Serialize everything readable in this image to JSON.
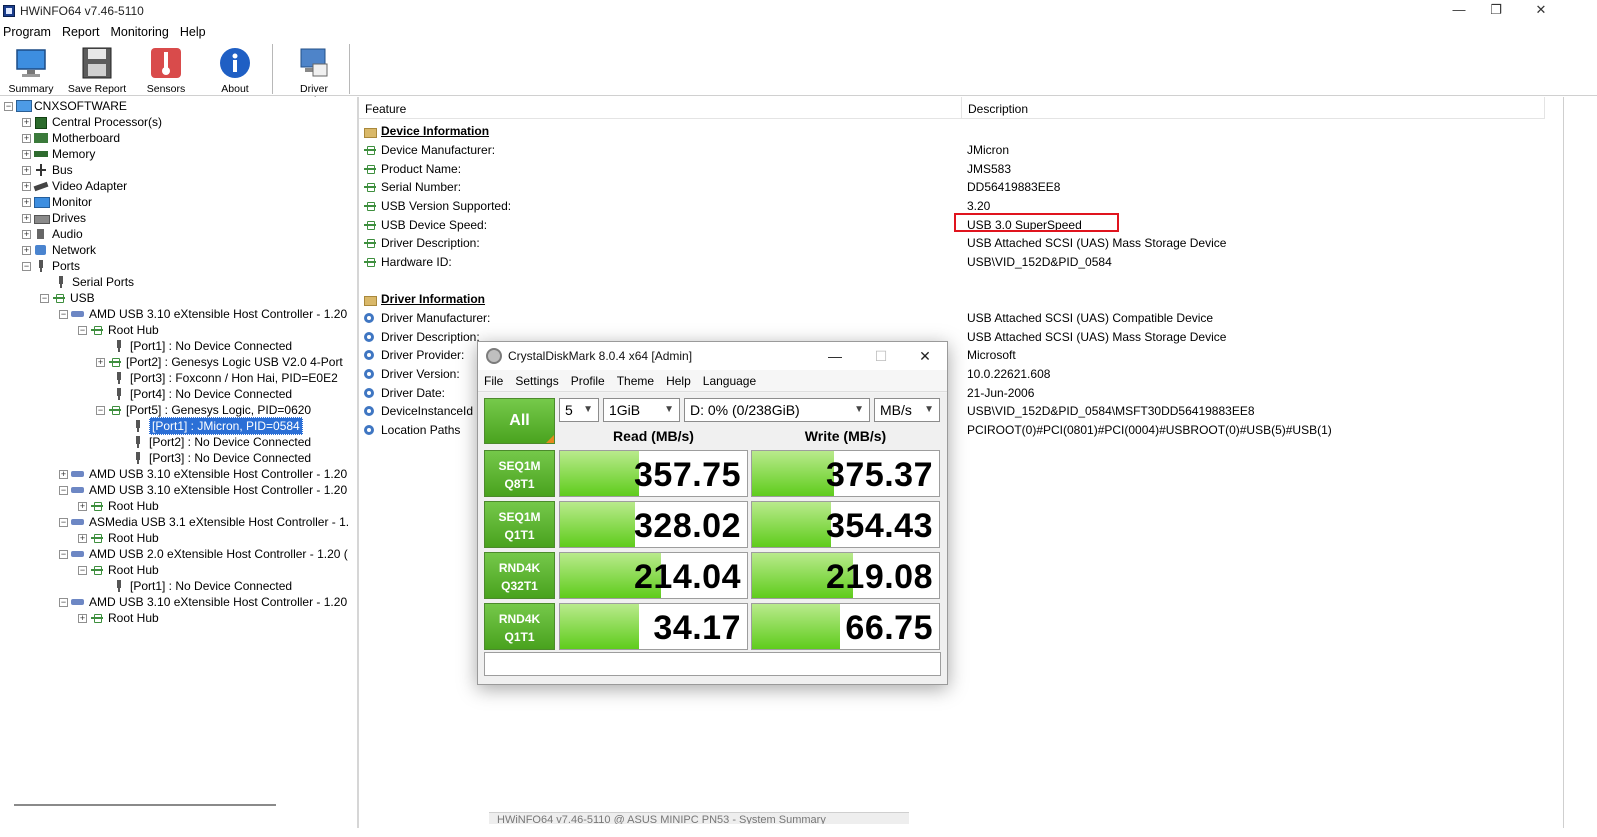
{
  "window": {
    "title": "HWiNFO64 v7.46-5110",
    "minimize": "—",
    "maximize": "❐",
    "close": "✕"
  },
  "menu": [
    "Program",
    "Report",
    "Monitoring",
    "Help"
  ],
  "toolbar": {
    "summary": "Summary",
    "save_report": "Save Report",
    "sensors": "Sensors",
    "about": "About",
    "driver_update": "Driver Update"
  },
  "tree": {
    "root": "CNXSOFTWARE",
    "items": [
      "Central Processor(s)",
      "Motherboard",
      "Memory",
      "Bus",
      "Video Adapter",
      "Monitor",
      "Drives",
      "Audio",
      "Network",
      "Ports",
      "Serial Ports",
      "USB",
      "AMD USB 3.10 eXtensible Host Controller - 1.20",
      "Root Hub",
      "[Port1] : No Device Connected",
      "[Port2] : Genesys Logic USB V2.0 4-Port",
      "[Port3] : Foxconn / Hon Hai, PID=E0E2",
      "[Port4] : No Device Connected",
      "[Port5] : Genesys Logic, PID=0620",
      "[Port1] : JMicron, PID=0584",
      "[Port2] : No Device Connected",
      "[Port3] : No Device Connected",
      "AMD USB 3.10 eXtensible Host Controller - 1.20",
      "AMD USB 3.10 eXtensible Host Controller - 1.20",
      "Root Hub",
      "ASMedia USB 3.1 eXtensible Host Controller - 1.",
      "Root Hub",
      "AMD USB 2.0 eXtensible Host Controller - 1.20 (",
      "Root Hub",
      "[Port1] : No Device Connected",
      "AMD USB 3.10 eXtensible Host Controller - 1.20",
      "Root Hub"
    ]
  },
  "table": {
    "col_feature": "Feature",
    "col_description": "Description",
    "section1": "Device Information",
    "device_rows": [
      {
        "feature": "Device Manufacturer:",
        "value": "JMicron"
      },
      {
        "feature": "Product Name:",
        "value": "JMS583"
      },
      {
        "feature": "Serial Number:",
        "value": "DD56419883EE8"
      },
      {
        "feature": "USB Version Supported:",
        "value": "3.20"
      },
      {
        "feature": "USB Device Speed:",
        "value": "USB 3.0 SuperSpeed"
      },
      {
        "feature": "Driver Description:",
        "value": "USB Attached SCSI (UAS) Mass Storage Device"
      },
      {
        "feature": "Hardware ID:",
        "value": "USB\\VID_152D&PID_0584"
      }
    ],
    "section2": "Driver Information",
    "driver_rows": [
      {
        "feature": "Driver Manufacturer:",
        "value": "USB Attached SCSI (UAS) Compatible Device"
      },
      {
        "feature": "Driver Description:",
        "value": "USB Attached SCSI (UAS) Mass Storage Device"
      },
      {
        "feature": "Driver Provider:",
        "value": "Microsoft"
      },
      {
        "feature": "Driver Version:",
        "value": "10.0.22621.608"
      },
      {
        "feature": "Driver Date:",
        "value": "21-Jun-2006"
      },
      {
        "feature": "DeviceInstanceId",
        "value": "USB\\VID_152D&PID_0584\\MSFT30DD56419883EE8"
      },
      {
        "feature": "Location Paths",
        "value": "PCIROOT(0)#PCI(0801)#PCI(0004)#USBROOT(0)#USB(5)#USB(1)"
      }
    ]
  },
  "status_strip": "HWiNFO64 v7.46-5110 @ ASUS MINIPC PN53 - System Summary",
  "colors": {
    "highlight_box": "#e0141e",
    "selection": "#2b6fd6",
    "cdm_green": "#4aa31f"
  },
  "cdm": {
    "title": "CrystalDiskMark 8.0.4 x64 [Admin]",
    "menu": [
      "File",
      "Settings",
      "Profile",
      "Theme",
      "Help",
      "Language"
    ],
    "all_button": "All",
    "count": "5",
    "size": "1GiB",
    "drive": "D: 0% (0/238GiB)",
    "unit": "MB/s",
    "read_header": "Read (MB/s)",
    "write_header": "Write (MB/s)",
    "tests": [
      {
        "line1": "SEQ1M",
        "line2": "Q8T1",
        "read": "357.75",
        "write": "375.37",
        "read_pct": 0.42,
        "write_pct": 0.44
      },
      {
        "line1": "SEQ1M",
        "line2": "Q1T1",
        "read": "328.02",
        "write": "354.43",
        "read_pct": 0.4,
        "write_pct": 0.42
      },
      {
        "line1": "RND4K",
        "line2": "Q32T1",
        "read": "214.04",
        "write": "219.08",
        "read_pct": 0.54,
        "write_pct": 0.54
      },
      {
        "line1": "RND4K",
        "line2": "Q1T1",
        "read": "34.17",
        "write": "66.75",
        "read_pct": 0.42,
        "write_pct": 0.47
      }
    ]
  }
}
